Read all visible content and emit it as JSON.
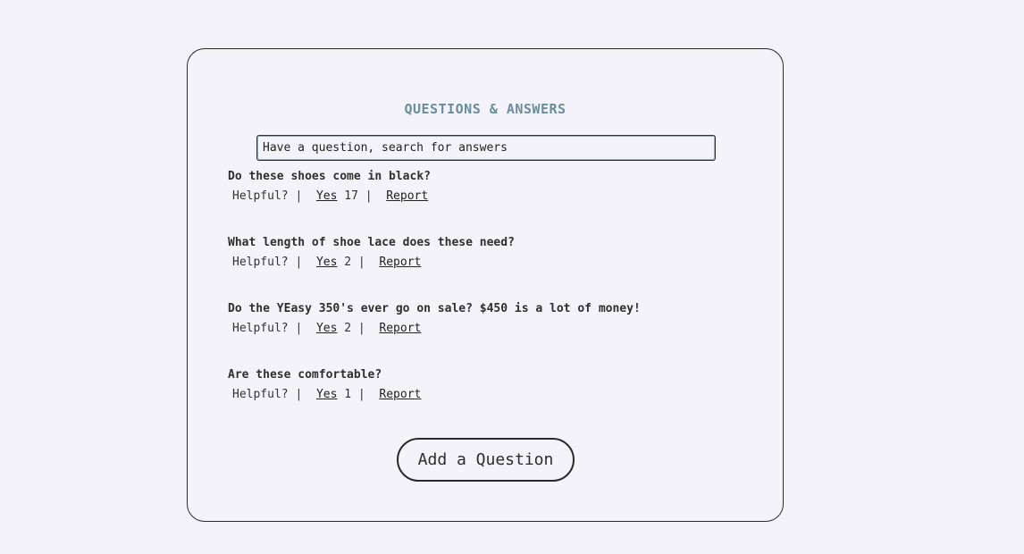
{
  "qa": {
    "title": "QUESTIONS & ANSWERS",
    "search_placeholder": "Have a question, search for answers",
    "helpful_label": "Helpful?",
    "yes_label": "Yes",
    "report_label": "Report",
    "separator": "|",
    "questions": [
      {
        "text": "Do these shoes come in black?",
        "helpful_count": "17"
      },
      {
        "text": "What length of shoe lace does these need?",
        "helpful_count": "2"
      },
      {
        "text": "Do the YEasy 350's ever go on sale? $450 is a lot of money!",
        "helpful_count": "2"
      },
      {
        "text": "Are these comfortable?",
        "helpful_count": "1"
      }
    ],
    "add_question_label": "Add a Question"
  }
}
